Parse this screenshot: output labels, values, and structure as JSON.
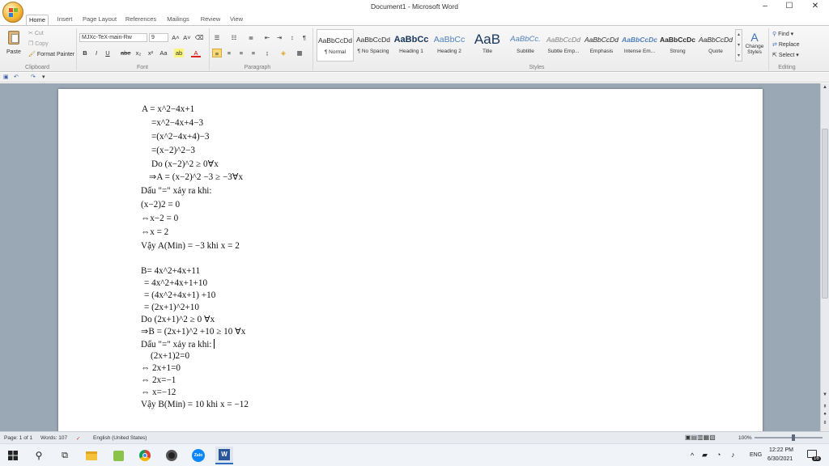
{
  "window": {
    "title": "Document1 - Microsoft Word",
    "controls": [
      "–",
      "☐",
      "✕"
    ]
  },
  "tabs": [
    "Home",
    "Insert",
    "Page Layout",
    "References",
    "Mailings",
    "Review",
    "View"
  ],
  "active_tab": "Home",
  "ribbon": {
    "clipboard": {
      "paste": "Paste",
      "cut": "Cut",
      "copy": "Copy",
      "format_painter": "Format Painter",
      "label": "Clipboard"
    },
    "font": {
      "name": "MJXc-TeX-main-Rw",
      "size": "9",
      "grow": "A˄",
      "shrink": "A˅",
      "bold": "B",
      "italic": "I",
      "underline": "U",
      "strike": "abe",
      "subscript": "x₂",
      "superscript": "x²",
      "change_case": "Aa",
      "label": "Font"
    },
    "paragraph": {
      "label": "Paragraph",
      "show_marks": "¶"
    },
    "styles": {
      "items": [
        {
          "preview": "AaBbCcDd",
          "name": "¶ Normal"
        },
        {
          "preview": "AaBbCcDd",
          "name": "¶ No Spacing"
        },
        {
          "preview": "AaBbCc",
          "name": "Heading 1"
        },
        {
          "preview": "AaBbCc",
          "name": "Heading 2"
        },
        {
          "preview": "AaB",
          "name": "Title"
        },
        {
          "preview": "AaBbCc.",
          "name": "Subtitle"
        },
        {
          "preview": "AaBbCcDd",
          "name": "Subtle Emp..."
        },
        {
          "preview": "AaBbCcDd",
          "name": "Emphasis"
        },
        {
          "preview": "AaBbCcDc",
          "name": "Intense Em..."
        },
        {
          "preview": "AaBbCcDc",
          "name": "Strong"
        },
        {
          "preview": "AaBbCcDd",
          "name": "Quote"
        }
      ],
      "change_styles": "Change Styles",
      "label": "Styles"
    },
    "editing": {
      "find": "Find",
      "replace": "Replace",
      "select": "Select",
      "label": "Editing"
    }
  },
  "document": {
    "lines": [
      "A = x^2−4x+1",
      "=x^2−4x+4−3",
      "=(x^2−4x+4)−3",
      "=(x−2)^2−3",
      "Do (x−2)^2 ≥ 0∀x",
      "⇒A = (x−2)^2 −3 ≥ −3∀x",
      "Dấu \"=\" xảy ra khi:",
      "(x−2)2 = 0",
      "⇔x−2 = 0",
      "⇔x = 2",
      "Vậy A(Min) = −3 khi x = 2",
      "B= 4x^2+4x+11",
      "= 4x^2+4x+1+10",
      "= (4x^2+4x+1) +10",
      "= (2x+1)^2+10",
      "Do (2x+1)^2 ≥ 0 ∀x",
      "⇒B = (2x+1)^2 +10 ≥ 10 ∀x",
      "Dấu \"=\" xảy ra khi:",
      "(2x+1)2=0",
      "⇔ 2x+1=0",
      "⇔ 2x=−1",
      "⇔ x=−12",
      "Vậy B(Min) = 10 khi x = −12"
    ]
  },
  "statusbar": {
    "page": "Page: 1 of 1",
    "words": "Words: 107",
    "language": "English (United States)",
    "zoom": "100%"
  },
  "taskbar": {
    "lang": "ENG",
    "time": "12:22 PM",
    "date": "6/30/2021",
    "notif_count": "16",
    "zalo": "Zalo"
  }
}
